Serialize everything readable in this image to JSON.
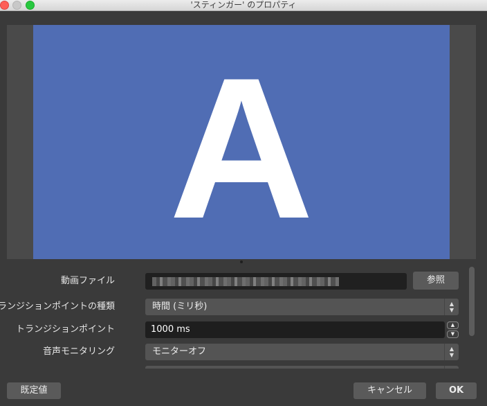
{
  "window": {
    "title": "'スティンガー' のプロパティ"
  },
  "preview": {
    "letter": "A",
    "background_color": "#506db4"
  },
  "form": {
    "video_file": {
      "label": "動画ファイル",
      "value": "",
      "browse_label": "参照"
    },
    "transition_point_type": {
      "label": "トランジションポイントの種類",
      "value": "時間 (ミリ秒)"
    },
    "transition_point": {
      "label": "トランジションポイント",
      "value": "1000 ms"
    },
    "audio_monitoring": {
      "label": "音声モニタリング",
      "value": "モニターオフ"
    }
  },
  "buttons": {
    "defaults": "既定値",
    "cancel": "キャンセル",
    "ok": "OK"
  }
}
